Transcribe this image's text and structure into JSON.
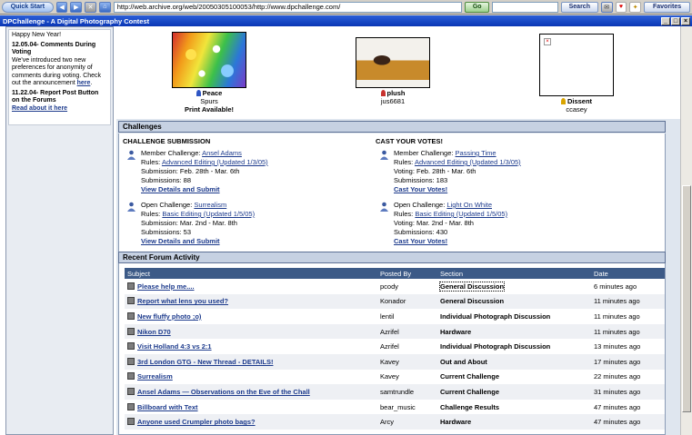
{
  "browser": {
    "start_label": "Quick Start",
    "address": "http://web.archive.org/web/20050305100053/http://www.dpchallenge.com/",
    "go_label": "Go",
    "search_label": "Search",
    "favorites_label": "Favorites",
    "window_title": "DPChallenge - A Digital Photography Contest"
  },
  "sidebar": {
    "line1": "Happy New Year!",
    "news1_head": "12.05.04- Comments During Voting",
    "news1_body": "We've introduced two new preferences for anonymity of comments during voting. Check out the announcement",
    "news1_link": "here",
    "news2_head": "11.22.04- Report Post Button on the Forums",
    "news2_link": "Read about it here"
  },
  "photos": [
    {
      "title": "Peace",
      "author": "Spurs",
      "extra": "Print Available!",
      "ribbon_color": "#2f56c4"
    },
    {
      "title": "plush",
      "author": "jus6681",
      "extra": "",
      "ribbon_color": "#c8322e"
    },
    {
      "title": "Dissent",
      "author": "ccasey",
      "extra": "",
      "ribbon_color": "#d9a400"
    }
  ],
  "challenges": {
    "section_title": "Challenges",
    "submission_head": "CHALLENGE SUBMISSION",
    "vote_head": "CAST YOUR VOTES!",
    "items": [
      {
        "type": "Member Challenge:",
        "name": "Ansel Adams",
        "rules_label": "Rules:",
        "rules": "Advanced Editing (Updated 1/3/05)",
        "dates": "Submission: Feb. 28th - Mar. 6th",
        "count": "Submissions: 88",
        "action": "View Details and Submit"
      },
      {
        "type": "Open Challenge:",
        "name": "Surrealism",
        "rules_label": "Rules:",
        "rules": "Basic Editing (Updated 1/5/05)",
        "dates": "Submission: Mar. 2nd - Mar. 8th",
        "count": "Submissions: 53",
        "action": "View Details and Submit"
      },
      {
        "type": "Member Challenge:",
        "name": "Passing Time",
        "rules_label": "Rules:",
        "rules": "Advanced Editing (Updated 1/3/05)",
        "dates": "Voting: Feb. 28th - Mar. 6th",
        "count": "Submissions: 183",
        "action": "Cast Your Votes!"
      },
      {
        "type": "Open Challenge:",
        "name": "Light On White",
        "rules_label": "Rules:",
        "rules": "Basic Editing (Updated 1/5/05)",
        "dates": "Voting: Mar. 2nd - Mar. 8th",
        "count": "Submissions: 430",
        "action": "Cast Your Votes!"
      }
    ]
  },
  "forum": {
    "section_title": "Recent Forum Activity",
    "columns": [
      "Subject",
      "Posted By",
      "Section",
      "Date"
    ],
    "rows": [
      {
        "subject": "Please help me....",
        "by": "pcody",
        "section": "General Discussion",
        "date": "6 minutes ago"
      },
      {
        "subject": "Report what lens you used?",
        "by": "Konador",
        "section": "General Discussion",
        "date": "11 minutes ago"
      },
      {
        "subject": "New fluffy photo ;o)",
        "by": "lentil",
        "section": "Individual Photograph Discussion",
        "date": "11 minutes ago"
      },
      {
        "subject": "Nikon D70",
        "by": "Azrifel",
        "section": "Hardware",
        "date": "11 minutes ago"
      },
      {
        "subject": "Visit Holland 4:3 vs 2:1",
        "by": "Azrifel",
        "section": "Individual Photograph Discussion",
        "date": "13 minutes ago"
      },
      {
        "subject": "3rd London GTG - New Thread - DETAILS!",
        "by": "Kavey",
        "section": "Out and About",
        "date": "17 minutes ago"
      },
      {
        "subject": "Surrealism",
        "by": "Kavey",
        "section": "Current Challenge",
        "date": "22 minutes ago"
      },
      {
        "subject": "Ansel Adams — Observations on the Eve of the Chall",
        "by": "samtrundle",
        "section": "Current Challenge",
        "date": "31 minutes ago"
      },
      {
        "subject": "Billboard with Text",
        "by": "bear_music",
        "section": "Challenge Results",
        "date": "47 minutes ago"
      },
      {
        "subject": "Anyone used Crumpler photo bags?",
        "by": "Arcy",
        "section": "Hardware",
        "date": "47 minutes ago"
      }
    ]
  }
}
